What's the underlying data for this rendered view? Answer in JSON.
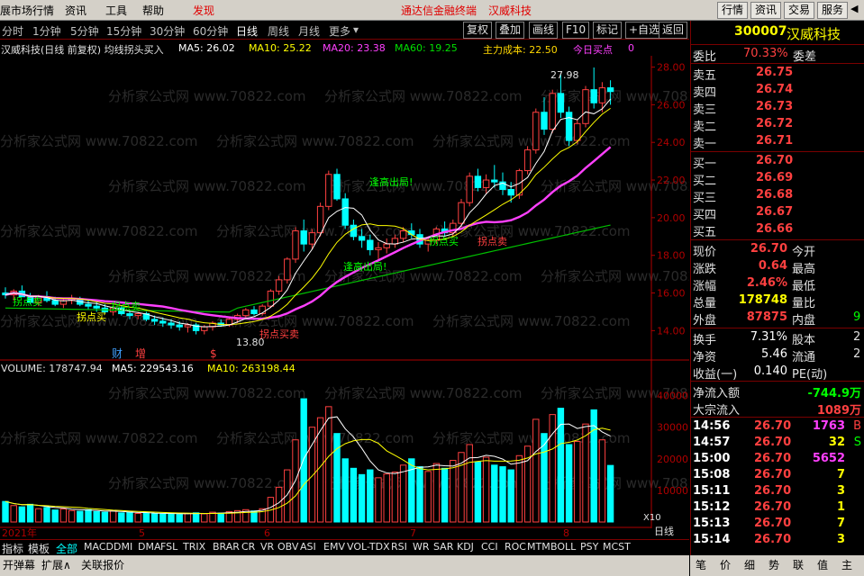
{
  "menu": {
    "market_label": "展市场行情",
    "info": "资讯",
    "tools": "工具",
    "help": "帮助",
    "discover": "发现",
    "center_title": "通达信金融终端",
    "stock_name": "汉威科技",
    "btn_quote": "行情",
    "btn_info": "资讯",
    "btn_trade": "交易",
    "btn_service": "服务"
  },
  "tabs": {
    "items": [
      "分时",
      "1分钟",
      "5分钟",
      "15分钟",
      "30分钟",
      "60分钟",
      "日线",
      "周线",
      "月线",
      "更多"
    ],
    "active": "日线",
    "dd_more": "▾",
    "right_buttons": [
      "复权",
      "叠加",
      "画线",
      "F10",
      "标记",
      "+自选",
      "返回"
    ]
  },
  "indicators": {
    "title": "汉威科技(日线 前复权) 均线拐头买入",
    "ma5": "MA5: 26.02",
    "ma10": "MA10: 25.22",
    "ma20": "MA20: 23.38",
    "ma60": "MA60: 19.25",
    "cost": "主力成本: 22.50",
    "buy_point": "今日买点",
    "buy_value": "0"
  },
  "annotations": {
    "high": "27.98",
    "low": "13.80",
    "exit1": "逢高出局!",
    "exit2": "逢高出局!",
    "sell1": "拐点卖",
    "sell2": "拐点卖",
    "sell_buy": "拐点买",
    "buy_sell": "拐点买卖",
    "mid1": "拐点买",
    "mid2": "拐点卖",
    "cai": "财",
    "zeng": "增",
    "dollar": "$",
    "watermark": "分析家公式网 www.70822.com",
    "year": "2021年",
    "months": [
      "5",
      "6",
      "7",
      "8"
    ],
    "x10": "X10",
    "daily": "日线"
  },
  "volume": {
    "label": "VOLUME: 178747.94",
    "ma5": "MA5: 229543.16",
    "ma10": "MA10: 263198.44",
    "ticks": [
      "40000",
      "30000",
      "20000",
      "10000"
    ]
  },
  "axis": {
    "price_ticks": [
      "28.00",
      "26.00",
      "24.00",
      "22.00",
      "20.00",
      "18.00",
      "16.00",
      "14.00"
    ]
  },
  "quote": {
    "code": "300007",
    "name": "汉威科技",
    "wb_label": "委比",
    "wb_value": "70.33%",
    "wc_label": "委差",
    "asks": [
      {
        "label": "卖五",
        "price": "26.75"
      },
      {
        "label": "卖四",
        "price": "26.74"
      },
      {
        "label": "卖三",
        "price": "26.73"
      },
      {
        "label": "卖二",
        "price": "26.72"
      },
      {
        "label": "卖一",
        "price": "26.71"
      }
    ],
    "bids": [
      {
        "label": "买一",
        "price": "26.70"
      },
      {
        "label": "买二",
        "price": "26.69"
      },
      {
        "label": "买三",
        "price": "26.68"
      },
      {
        "label": "买四",
        "price": "26.67"
      },
      {
        "label": "买五",
        "price": "26.66"
      }
    ],
    "stats": [
      {
        "l": "现价",
        "v": "26.70",
        "l2": "今开",
        "v2": ""
      },
      {
        "l": "涨跌",
        "v": "0.64",
        "l2": "最高",
        "v2": ""
      },
      {
        "l": "涨幅",
        "v": "2.46%",
        "l2": "最低",
        "v2": ""
      },
      {
        "l": "总量",
        "v": "178748",
        "l2": "量比",
        "v2": ""
      },
      {
        "l": "外盘",
        "v": "87875",
        "l2": "内盘",
        "v2": "9"
      }
    ],
    "stats2": [
      {
        "l": "换手",
        "v": "7.31%",
        "l2": "股本",
        "v2": "2"
      },
      {
        "l": "净资",
        "v": "5.46",
        "l2": "流通",
        "v2": "2"
      },
      {
        "l": "收益(一)",
        "v": "0.140",
        "l2": "PE(动)",
        "v2": ""
      }
    ],
    "flow": [
      {
        "l": "净流入额",
        "v": "-744.9万"
      },
      {
        "l": "大宗流入",
        "v": "1089万"
      }
    ],
    "ticks": [
      {
        "t": "14:56",
        "p": "26.70",
        "v": "1763",
        "f": "B"
      },
      {
        "t": "14:57",
        "p": "26.70",
        "v": "32",
        "f": "S"
      },
      {
        "t": "15:00",
        "p": "26.70",
        "v": "5652",
        "f": ""
      },
      {
        "t": "15:08",
        "p": "26.70",
        "v": "7",
        "f": ""
      },
      {
        "t": "15:11",
        "p": "26.70",
        "v": "3",
        "f": ""
      },
      {
        "t": "15:12",
        "p": "26.70",
        "v": "1",
        "f": ""
      },
      {
        "t": "15:13",
        "p": "26.70",
        "v": "7",
        "f": ""
      },
      {
        "t": "15:14",
        "p": "26.70",
        "v": "3",
        "f": ""
      }
    ],
    "bottom_tabs": [
      "笔",
      "价",
      "细",
      "势",
      "联",
      "值",
      "主"
    ]
  },
  "indicator_bar": {
    "items": [
      "指标",
      "模板",
      "全部",
      "MACD",
      "DMI",
      "DMA",
      "FSL",
      "TRIX",
      "BRAR",
      "CR",
      "VR",
      "OBV",
      "ASI",
      "EMV",
      "VOL-TDX",
      "RSI",
      "WR",
      "SAR",
      "KDJ",
      "CCI",
      "ROC",
      "MTM",
      "BOLL",
      "PSY",
      "MCST"
    ],
    "active": "全部"
  },
  "status_bar": {
    "items": [
      "开弹幕",
      "扩展∧",
      "关联报价"
    ]
  },
  "chart_data": {
    "type": "candlestick",
    "price_range": [
      13.3,
      28.6
    ],
    "volume_range": [
      0,
      45000
    ],
    "candles": [
      [
        16.0,
        16.3,
        15.7,
        15.9
      ],
      [
        15.9,
        16.2,
        15.6,
        16.1
      ],
      [
        16.1,
        16.4,
        15.8,
        15.8
      ],
      [
        15.8,
        16.0,
        15.4,
        15.5
      ],
      [
        15.5,
        15.9,
        15.3,
        15.8
      ],
      [
        15.8,
        16.1,
        15.5,
        15.6
      ],
      [
        15.6,
        15.8,
        15.3,
        15.4
      ],
      [
        15.4,
        15.7,
        15.2,
        15.6
      ],
      [
        15.6,
        15.9,
        15.4,
        15.7
      ],
      [
        15.7,
        15.8,
        15.3,
        15.4
      ],
      [
        15.4,
        15.6,
        15.1,
        15.3
      ],
      [
        15.3,
        15.5,
        15.0,
        15.2
      ],
      [
        15.2,
        15.4,
        14.9,
        15.0
      ],
      [
        15.0,
        15.3,
        14.8,
        15.2
      ],
      [
        15.2,
        15.3,
        14.8,
        14.9
      ],
      [
        14.9,
        15.1,
        14.6,
        14.8
      ],
      [
        14.8,
        15.0,
        14.6,
        14.9
      ],
      [
        14.9,
        15.0,
        14.5,
        14.6
      ],
      [
        14.6,
        14.8,
        14.3,
        14.5
      ],
      [
        14.5,
        14.7,
        14.2,
        14.4
      ],
      [
        14.4,
        14.6,
        14.1,
        14.3
      ],
      [
        14.3,
        14.5,
        14.0,
        14.2
      ],
      [
        14.2,
        14.4,
        13.9,
        14.3
      ],
      [
        14.3,
        14.4,
        13.8,
        14.0
      ],
      [
        14.0,
        14.3,
        13.8,
        14.2
      ],
      [
        14.2,
        14.5,
        14.0,
        14.4
      ],
      [
        14.4,
        14.6,
        14.2,
        14.3
      ],
      [
        14.3,
        14.7,
        14.2,
        14.6
      ],
      [
        14.6,
        14.9,
        14.4,
        14.8
      ],
      [
        14.8,
        15.2,
        14.7,
        15.1
      ],
      [
        15.1,
        15.3,
        14.8,
        14.9
      ],
      [
        14.9,
        15.4,
        14.8,
        15.3
      ],
      [
        15.3,
        16.2,
        15.2,
        16.1
      ],
      [
        16.1,
        16.9,
        15.9,
        16.7
      ],
      [
        16.7,
        17.9,
        16.5,
        17.8
      ],
      [
        17.8,
        19.5,
        17.6,
        19.3
      ],
      [
        19.3,
        19.9,
        18.2,
        18.6
      ],
      [
        18.6,
        19.4,
        18.3,
        19.2
      ],
      [
        19.2,
        20.8,
        19.0,
        20.6
      ],
      [
        20.6,
        22.5,
        20.4,
        22.3
      ],
      [
        22.3,
        22.6,
        20.9,
        21.0
      ],
      [
        21.0,
        21.3,
        19.4,
        19.6
      ],
      [
        19.6,
        19.9,
        18.8,
        19.0
      ],
      [
        19.0,
        19.4,
        18.4,
        18.8
      ],
      [
        18.8,
        19.1,
        18.0,
        18.3
      ],
      [
        18.3,
        18.7,
        17.8,
        18.4
      ],
      [
        18.4,
        18.9,
        18.1,
        18.6
      ],
      [
        18.6,
        19.1,
        18.4,
        18.9
      ],
      [
        18.9,
        19.5,
        18.7,
        19.3
      ],
      [
        19.3,
        19.7,
        18.9,
        19.1
      ],
      [
        19.1,
        19.4,
        18.4,
        18.6
      ],
      [
        18.6,
        19.0,
        18.2,
        18.8
      ],
      [
        18.8,
        19.5,
        18.6,
        19.4
      ],
      [
        19.4,
        19.8,
        19.0,
        19.2
      ],
      [
        19.2,
        19.9,
        19.0,
        19.7
      ],
      [
        19.7,
        21.0,
        19.5,
        20.8
      ],
      [
        20.8,
        22.4,
        20.6,
        22.2
      ],
      [
        22.2,
        22.6,
        21.4,
        21.6
      ],
      [
        21.6,
        22.3,
        21.3,
        22.0
      ],
      [
        22.0,
        22.8,
        21.6,
        21.9
      ],
      [
        21.9,
        22.4,
        21.2,
        21.5
      ],
      [
        21.5,
        21.9,
        20.8,
        21.2
      ],
      [
        21.2,
        22.6,
        21.0,
        22.5
      ],
      [
        22.5,
        23.8,
        22.3,
        23.6
      ],
      [
        23.6,
        25.8,
        23.4,
        25.6
      ],
      [
        25.6,
        26.4,
        24.4,
        24.7
      ],
      [
        24.7,
        26.8,
        24.5,
        26.6
      ],
      [
        26.6,
        27.6,
        25.3,
        25.6
      ],
      [
        25.6,
        25.9,
        23.8,
        24.1
      ],
      [
        24.1,
        25.2,
        23.9,
        25.0
      ],
      [
        25.0,
        27.0,
        24.8,
        26.8
      ],
      [
        26.8,
        27.98,
        25.8,
        26.1
      ],
      [
        26.1,
        27.2,
        25.6,
        26.9
      ],
      [
        26.9,
        27.3,
        26.0,
        26.7
      ]
    ],
    "volumes": [
      6500,
      5200,
      4800,
      5600,
      4200,
      4600,
      3800,
      4100,
      3600,
      3400,
      3900,
      3300,
      3100,
      3500,
      2900,
      3000,
      2700,
      2900,
      2600,
      2500,
      2800,
      2400,
      2700,
      2900,
      2600,
      3100,
      2800,
      3300,
      3600,
      3900,
      3500,
      4200,
      7800,
      11000,
      16500,
      26000,
      39000,
      30000,
      33000,
      36500,
      28000,
      20000,
      17000,
      15000,
      16500,
      14000,
      15200,
      15800,
      18000,
      20000,
      17500,
      16000,
      18500,
      17000,
      19500,
      22000,
      24500,
      19000,
      20500,
      18000,
      17500,
      16500,
      21000,
      24000,
      32500,
      28000,
      34000,
      36000,
      24500,
      25500,
      31000,
      35500,
      26000,
      17900
    ],
    "ma_lines": [
      "MA5",
      "MA10",
      "MA20",
      "MA60"
    ],
    "colors": {
      "up": "#ff4040",
      "down": "#00ffff",
      "ma5": "#ffffff",
      "ma10": "#ffff00",
      "ma20": "#ff40ff",
      "ma60": "#00c000",
      "axis": "#b00000"
    }
  }
}
